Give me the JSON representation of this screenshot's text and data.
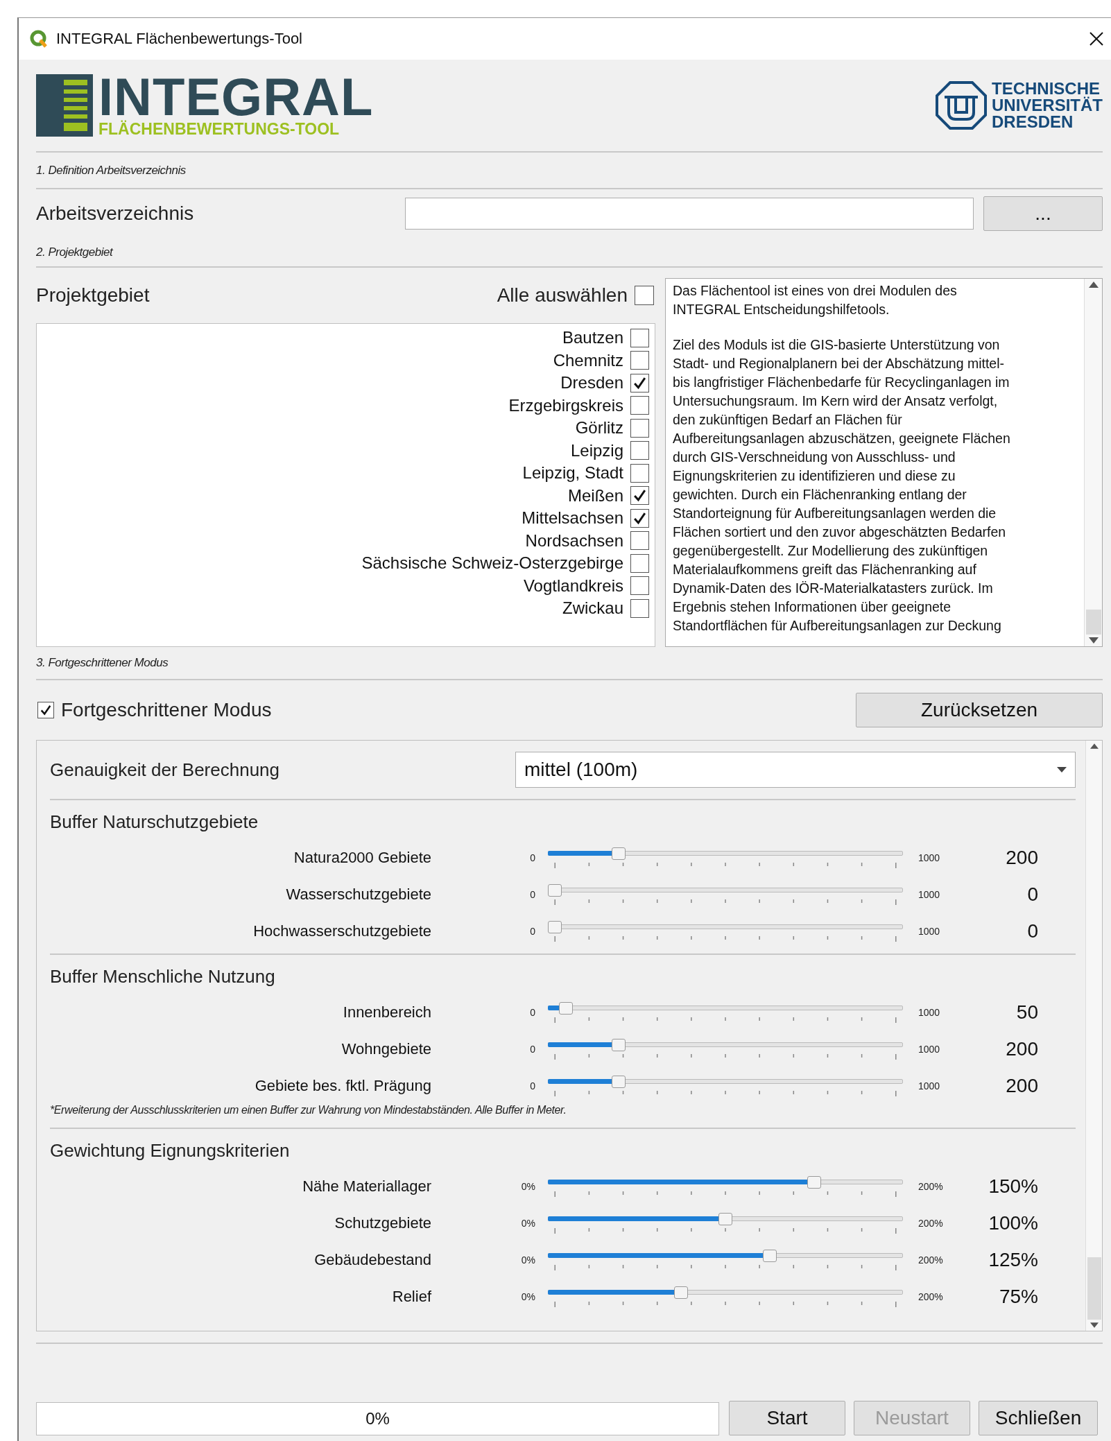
{
  "window": {
    "title": "INTEGRAL Flächenbewertungs-Tool"
  },
  "header": {
    "logo_title": "INTEGRAL",
    "logo_subtitle": "FLÄCHENBEWERTUNGS-TOOL",
    "university": [
      "TECHNISCHE",
      "UNIVERSITÄT",
      "DRESDEN"
    ]
  },
  "section_1": {
    "heading": "1. Definition Arbeitsverzeichnis",
    "label": "Arbeitsverzeichnis",
    "browse_button": "..."
  },
  "section_2": {
    "heading": "2. Projektgebiet",
    "label": "Projektgebiet",
    "select_all": {
      "label": "Alle auswählen",
      "checked": false
    },
    "regions": [
      {
        "name": "Bautzen",
        "checked": false
      },
      {
        "name": "Chemnitz",
        "checked": false
      },
      {
        "name": "Dresden",
        "checked": true
      },
      {
        "name": "Erzgebirgskreis",
        "checked": false
      },
      {
        "name": "Görlitz",
        "checked": false
      },
      {
        "name": "Leipzig",
        "checked": false
      },
      {
        "name": "Leipzig, Stadt",
        "checked": false
      },
      {
        "name": "Meißen",
        "checked": true
      },
      {
        "name": "Mittelsachsen",
        "checked": true
      },
      {
        "name": "Nordsachsen",
        "checked": false
      },
      {
        "name": "Sächsische Schweiz-Osterzgebirge",
        "checked": false
      },
      {
        "name": "Vogtlandkreis",
        "checked": false
      },
      {
        "name": "Zwickau",
        "checked": false
      }
    ],
    "info_text": [
      "Das Flächentool ist eines von drei Modulen des\nINTEGRAL Entscheidungshilfetools.",
      "Ziel des Moduls ist die GIS-basierte Unterstützung von\nStadt- und Regionalplanern bei der Abschätzung mittel-\nbis langfristiger Flächenbedarfe für Recyclinganlagen im\nUntersuchungsraum. Im Kern wird der Ansatz verfolgt,\nden zukünftigen Bedarf an Flächen für\nAufbereitungsanlagen abzuschätzen, geeignete Flächen\ndurch GIS-Verschneidung von Ausschluss- und\nEignungskriterien zu identifizieren und diese zu\ngewichten. Durch ein Flächenranking entlang der\nStandorteignung für Aufbereitungsanlagen werden die\nFlächen sortiert und den zuvor abgeschätzten Bedarfen\ngegenübergestellt. Zur Modellierung des zukünftigen\nMaterialaufkommens greift das Flächenranking auf\nDynamik-Daten des IÖR-Materialkatasters zurück. Im\nErgebnis stehen Informationen über geeignete\nStandortflächen für Aufbereitungsanlagen zur Deckung"
    ]
  },
  "section_3": {
    "heading": "3. Fortgeschrittener Modus",
    "advanced_mode": {
      "label": "Fortgeschrittener Modus",
      "checked": true
    },
    "reset_button": "Zurücksetzen",
    "accuracy": {
      "label": "Genauigkeit der Berechnung",
      "value": "mittel (100m)"
    },
    "groups": [
      {
        "title": "Buffer Naturschutzgebiete",
        "sliders": [
          {
            "label": "Natura2000 Gebiete",
            "min": "0",
            "max": "1000",
            "value": "200",
            "level": 0.2
          },
          {
            "label": "Wasserschutzgebiete",
            "min": "0",
            "max": "1000",
            "value": "0",
            "level": 0
          },
          {
            "label": "Hochwasserschutzgebiete",
            "min": "0",
            "max": "1000",
            "value": "0",
            "level": 0
          }
        ]
      },
      {
        "title": "Buffer Menschliche Nutzung",
        "sliders": [
          {
            "label": "Innenbereich",
            "min": "0",
            "max": "1000",
            "value": "50",
            "level": 0.05
          },
          {
            "label": "Wohngebiete",
            "min": "0",
            "max": "1000",
            "value": "200",
            "level": 0.2
          },
          {
            "label": "Gebiete bes. fktl. Prägung",
            "min": "0",
            "max": "1000",
            "value": "200",
            "level": 0.2
          }
        ],
        "note": "*Erweiterung der Ausschlusskriterien um einen Buffer zur Wahrung von Mindestabständen. Alle Buffer in Meter."
      },
      {
        "title": "Gewichtung Eignungskriterien",
        "sliders": [
          {
            "label": "Nähe Materiallager",
            "min": "0%",
            "max": "200%",
            "value": "150%",
            "level": 0.75
          },
          {
            "label": "Schutzgebiete",
            "min": "0%",
            "max": "200%",
            "value": "100%",
            "level": 0.5
          },
          {
            "label": "Gebäudebestand",
            "min": "0%",
            "max": "200%",
            "value": "125%",
            "level": 0.625
          },
          {
            "label": "Relief",
            "min": "0%",
            "max": "200%",
            "value": "75%",
            "level": 0.375
          }
        ]
      }
    ]
  },
  "footer": {
    "progress": {
      "level": 0,
      "text": "0%"
    },
    "buttons": [
      {
        "label": "Start",
        "disabled": false
      },
      {
        "label": "Neustart",
        "disabled": true
      },
      {
        "label": "Schließen",
        "disabled": false
      }
    ]
  }
}
